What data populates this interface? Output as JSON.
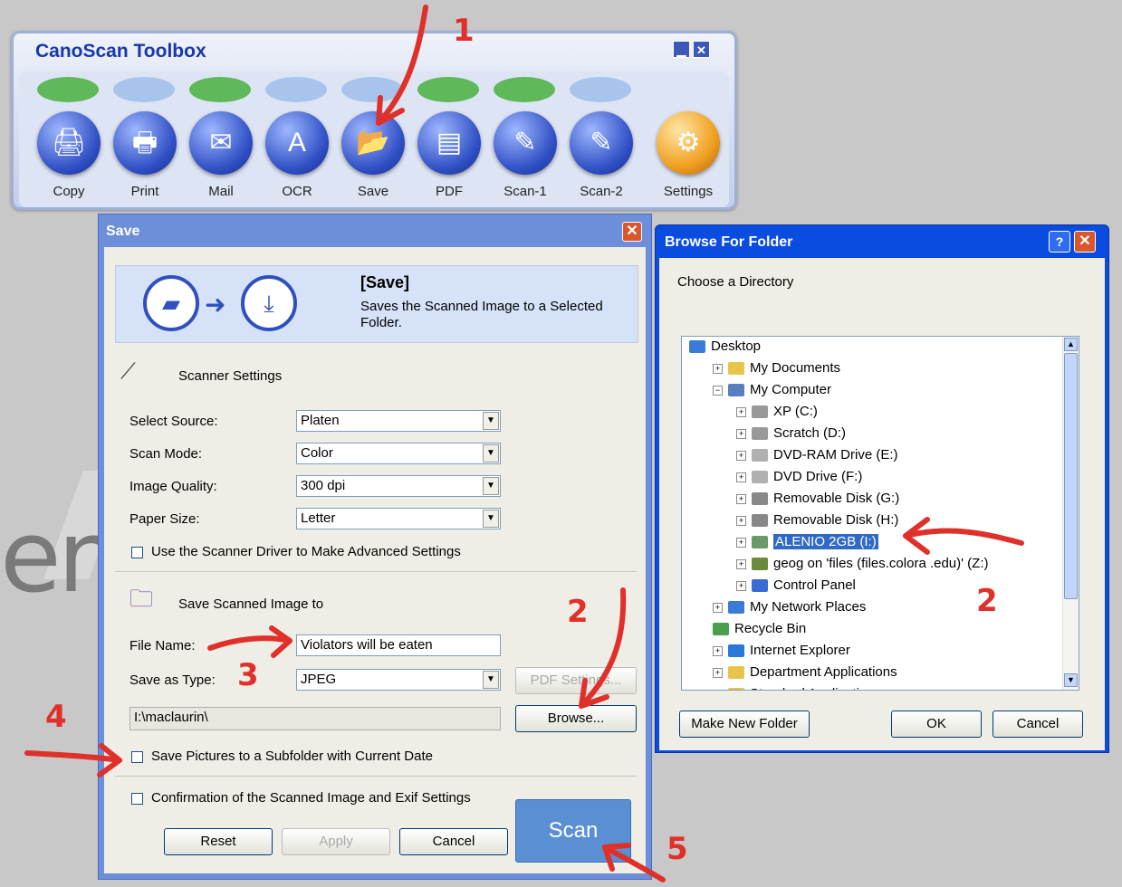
{
  "background_text": "en",
  "toolbox": {
    "title": "CanoScan Toolbox",
    "items": [
      {
        "label": "Copy",
        "icon": "copy-icon",
        "glyph": "🖨"
      },
      {
        "label": "Print",
        "icon": "print-icon",
        "glyph": "🖶"
      },
      {
        "label": "Mail",
        "icon": "mail-icon",
        "glyph": "✉"
      },
      {
        "label": "OCR",
        "icon": "ocr-icon",
        "glyph": "A"
      },
      {
        "label": "Save",
        "icon": "save-icon",
        "glyph": "📂"
      },
      {
        "label": "PDF",
        "icon": "pdf-icon",
        "glyph": "▤"
      },
      {
        "label": "Scan-1",
        "icon": "scan-1-icon",
        "glyph": "✎"
      },
      {
        "label": "Scan-2",
        "icon": "scan-2-icon",
        "glyph": "✎"
      },
      {
        "label": "Settings",
        "icon": "settings-icon",
        "glyph": "⚙"
      }
    ]
  },
  "save_dialog": {
    "title": "Save",
    "banner_title": "[Save]",
    "banner_desc_1": "Saves the Scanned Image to a Selected",
    "banner_desc_2": "Folder.",
    "scanner_settings_label": "Scanner Settings",
    "fields": [
      {
        "label": "Select Source:",
        "value": "Platen"
      },
      {
        "label": "Scan Mode:",
        "value": "Color"
      },
      {
        "label": "Image Quality:",
        "value": "300 dpi"
      },
      {
        "label": "Paper Size:",
        "value": "Letter"
      }
    ],
    "advanced_checkbox": "Use the Scanner Driver to Make Advanced Settings",
    "save_section_label": "Save Scanned Image to",
    "file_name_label": "File Name:",
    "file_name_value": "Violators will be eaten",
    "save_type_label": "Save as Type:",
    "save_type_value": "JPEG",
    "pdf_settings_button": "PDF Settings...",
    "path_value": "I:\\maclaurin\\",
    "browse_button": "Browse...",
    "subfolder_checkbox": "Save Pictures to a Subfolder with Current Date",
    "confirm_checkbox": "Confirmation of the Scanned Image and Exif Settings",
    "reset_button": "Reset",
    "apply_button": "Apply",
    "cancel_button": "Cancel",
    "scan_button": "Scan"
  },
  "browse_dialog": {
    "title": "Browse For Folder",
    "help": "?",
    "prompt": "Choose a Directory",
    "tree": [
      {
        "label": "Desktop",
        "level": 0,
        "pm": "",
        "icon": "desktop-icon"
      },
      {
        "label": "My Documents",
        "level": 1,
        "pm": "+",
        "icon": "folder-icon"
      },
      {
        "label": "My Computer",
        "level": 1,
        "pm": "−",
        "icon": "computer-icon"
      },
      {
        "label": "XP (C:)",
        "level": 2,
        "pm": "+",
        "icon": "drive-icon"
      },
      {
        "label": "Scratch (D:)",
        "level": 2,
        "pm": "+",
        "icon": "drive-icon"
      },
      {
        "label": "DVD-RAM Drive (E:)",
        "level": 2,
        "pm": "+",
        "icon": "disc-icon"
      },
      {
        "label": "DVD Drive (F:)",
        "level": 2,
        "pm": "+",
        "icon": "disc-icon"
      },
      {
        "label": "Removable Disk (G:)",
        "level": 2,
        "pm": "+",
        "icon": "removable-disk-icon"
      },
      {
        "label": "Removable Disk (H:)",
        "level": 2,
        "pm": "+",
        "icon": "removable-disk-icon"
      },
      {
        "label": "ALENIO 2GB (I:)",
        "level": 2,
        "pm": "+",
        "icon": "usb-drive-icon",
        "selected": true
      },
      {
        "label": "geog on 'files (files.colora    .edu)' (Z:)",
        "level": 2,
        "pm": "+",
        "icon": "network-drive-icon"
      },
      {
        "label": "Control Panel",
        "level": 2,
        "pm": "+",
        "icon": "control-panel-icon"
      },
      {
        "label": "My Network Places",
        "level": 1,
        "pm": "+",
        "icon": "network-icon"
      },
      {
        "label": "Recycle Bin",
        "level": 1,
        "pm": "",
        "icon": "recycle-bin-icon"
      },
      {
        "label": "Internet Explorer",
        "level": 1,
        "pm": "+",
        "icon": "internet-explorer-icon"
      },
      {
        "label": "Department Applications",
        "level": 1,
        "pm": "+",
        "icon": "folder-icon"
      },
      {
        "label": "Standard Applications",
        "level": 1,
        "pm": "+",
        "icon": "folder-icon"
      }
    ],
    "make_folder_button": "Make New Folder",
    "ok_button": "OK",
    "cancel_button": "Cancel"
  },
  "annotations": [
    "1",
    "2",
    "2",
    "3",
    "4",
    "5"
  ],
  "colors": {
    "annotation": "#e0302a",
    "xp_blue": "#0a4ce0",
    "selection": "#316ac5"
  }
}
